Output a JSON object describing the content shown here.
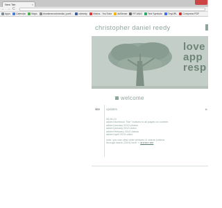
{
  "browser": {
    "tab_title": "New Tab",
    "tab_close": "×",
    "nav": {
      "back": "←",
      "forward": "→",
      "reload": "C"
    },
    "bookmarks": [
      {
        "label": "Apps",
        "color": "#7a8a99"
      },
      {
        "label": "Calendar",
        "color": "#4a7bd0"
      },
      {
        "label": "Maps",
        "color": "#4caf50"
      },
      {
        "label": "drunkenmonkmedia | portf...",
        "color": "#888888"
      },
      {
        "label": "cdreedy",
        "color": "#3b5998"
      },
      {
        "label": "Videos - YouTube",
        "color": "#d33"
      },
      {
        "label": "AdSense",
        "color": "#f4b400"
      },
      {
        "label": "RT-MAG",
        "color": "#666666"
      },
      {
        "label": "Text Symbols",
        "color": "#2a6"
      },
      {
        "label": "TinyURL",
        "color": "#4169e1"
      },
      {
        "label": "Compress PDF",
        "color": "#c33"
      }
    ]
  },
  "site": {
    "title": "christopher daniel reedy",
    "hero_lines": [
      "love",
      "app",
      "resp"
    ]
  },
  "main": {
    "welcome": "welcome",
    "side_label": "site",
    "updates_label": "updates",
    "right_label": "u",
    "updates": [
      "05.05.13",
      "added facebook \"like\" buttons to all pages on content",
      "added january 2013 photos",
      "added january 2013 video",
      "added february 2013 videos",
      "added april 2013 video"
    ],
    "note_lines": [
      "note: you can view older pictures & videos (videos",
      "through march 2010) here: »"
    ],
    "archive_link": "archive site"
  },
  "colors": {
    "accent": "#8fa59a",
    "hero_bg": "#c4cec8",
    "hero_text": "#6d8478"
  }
}
